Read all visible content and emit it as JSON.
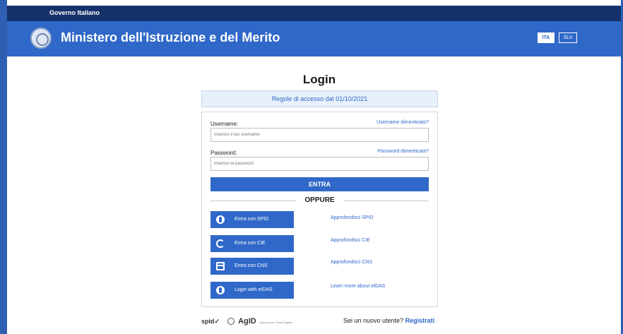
{
  "gov_bar": {
    "label": "Governo Italiano"
  },
  "header": {
    "title": "Ministero dell'Istruzione e del Merito",
    "languages": [
      "ITA",
      "SLV"
    ],
    "emblem_icon": "republic-emblem-icon"
  },
  "login": {
    "title": "Login",
    "rules_link": "Regole di accesso dal 01/10/2021",
    "username_label": "Username:",
    "username_forgot": "Username dimenticato?",
    "username_placeholder": "Inserisci il tuo username",
    "password_label": "Password:",
    "password_forgot": "Password dimenticata?",
    "password_placeholder": "Inserisci la password",
    "submit_label": "ENTRA",
    "or_label": "OPPURE"
  },
  "auth_options": [
    {
      "button": "Entra con SPID",
      "link": "Approfondisci SPID",
      "icon": "spid-user-icon"
    },
    {
      "button": "Entra con CIE",
      "link": "Approfondisci CIE",
      "icon": "cie-icon"
    },
    {
      "button": "Entra con CNS",
      "link": "Approfondisci CNS",
      "icon": "card-icon"
    },
    {
      "button": "Login with eIDAS",
      "link": "Learn more about eIDAS",
      "icon": "eidas-user-icon"
    }
  ],
  "footer": {
    "spid_logo": "spid✓",
    "agid_logo": "AgID",
    "agid_subtitle": "Agenzia per l'Italia Digitale",
    "register_prompt": "Sei un nuovo utente?",
    "register_link": "Registrati"
  },
  "colors": {
    "primary": "#2f68c8",
    "gov_bar": "#15326b",
    "info_bg": "#e7f0fb"
  }
}
